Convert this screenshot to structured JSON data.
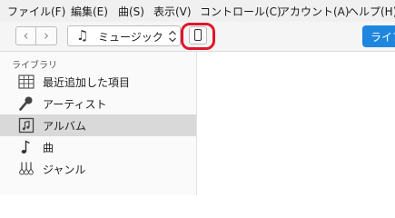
{
  "menu": [
    "ファイル(F)",
    "編集(E)",
    "曲(S)",
    "表示(V)",
    "コントロール(C)",
    "アカウント(A)",
    "ヘルプ(H)"
  ],
  "toolbar": {
    "media_select_value": "ミュージック",
    "library_button": "ライブラリ"
  },
  "sidebar": {
    "section_title": "ライブラリ",
    "items": [
      {
        "label": "最近追加した項目",
        "icon": "grid-icon"
      },
      {
        "label": "アーティスト",
        "icon": "microphone-icon"
      },
      {
        "label": "アルバム",
        "icon": "album-icon",
        "selected": true
      },
      {
        "label": "曲",
        "icon": "music-note-icon"
      },
      {
        "label": "ジャンル",
        "icon": "guitar-icon"
      }
    ]
  },
  "colors": {
    "accent": "#1f86e0",
    "highlight_ring": "#e0162b",
    "selected_row": "#d9d9d9"
  }
}
